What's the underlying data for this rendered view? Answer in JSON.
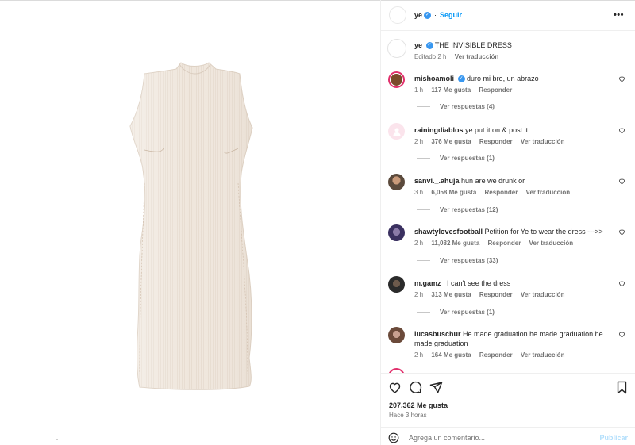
{
  "post": {
    "author": "ye",
    "follow_label": "Seguir",
    "more_label": "•••",
    "caption_author": "ye",
    "caption_text": "THE INVISIBLE DRESS",
    "caption_edited": "Editado",
    "caption_time": "2 h",
    "caption_translate": "Ver traducción"
  },
  "comments": [
    {
      "user": "mishoamoli",
      "verified": true,
      "text": "duro mi bro, un abrazo",
      "time": "1 h",
      "likes": "117 Me gusta",
      "reply": "Responder",
      "translate": "",
      "view_replies": "Ver respuestas (4)",
      "avatar_color": "#7a4b2a"
    },
    {
      "user": "rainingdiablos",
      "verified": false,
      "text": "ye put it on & post it",
      "time": "2 h",
      "likes": "376 Me gusta",
      "reply": "Responder",
      "translate": "Ver traducción",
      "view_replies": "Ver respuestas (1)",
      "avatar_color": "#f7d3e1"
    },
    {
      "user": "sanvi._.ahuja",
      "verified": false,
      "text": "hun are we drunk or",
      "time": "3 h",
      "likes": "6,058 Me gusta",
      "reply": "Responder",
      "translate": "Ver traducción",
      "view_replies": "Ver respuestas (12)",
      "avatar_color": "#5b4a3c"
    },
    {
      "user": "shawtylovesfootball",
      "verified": false,
      "text": "Petition for Ye to wear the dress --->>",
      "time": "2 h",
      "likes": "11,082 Me gusta",
      "reply": "Responder",
      "translate": "Ver traducción",
      "view_replies": "Ver respuestas (33)",
      "avatar_color": "#3a3060"
    },
    {
      "user": "m.gamz_",
      "verified": false,
      "text": "I can't see the dress",
      "time": "2 h",
      "likes": "313 Me gusta",
      "reply": "Responder",
      "translate": "Ver traducción",
      "view_replies": "Ver respuestas (1)",
      "avatar_color": "#2b2b2b"
    },
    {
      "user": "lucasbuschur",
      "verified": false,
      "text": "He made graduation he made graduation he made graduation",
      "time": "2 h",
      "likes": "164 Me gusta",
      "reply": "Responder",
      "translate": "Ver traducción",
      "view_replies": "",
      "avatar_color": "#6b4a3a"
    }
  ],
  "footer": {
    "likes": "207.362 Me gusta",
    "time": "Hace 3 horas",
    "comment_placeholder": "Agrega un comentario...",
    "publish_label": "Publicar"
  },
  "colors": {
    "accent": "#0095f6",
    "verified": "#3897f0",
    "dress": "#efe6dc"
  }
}
